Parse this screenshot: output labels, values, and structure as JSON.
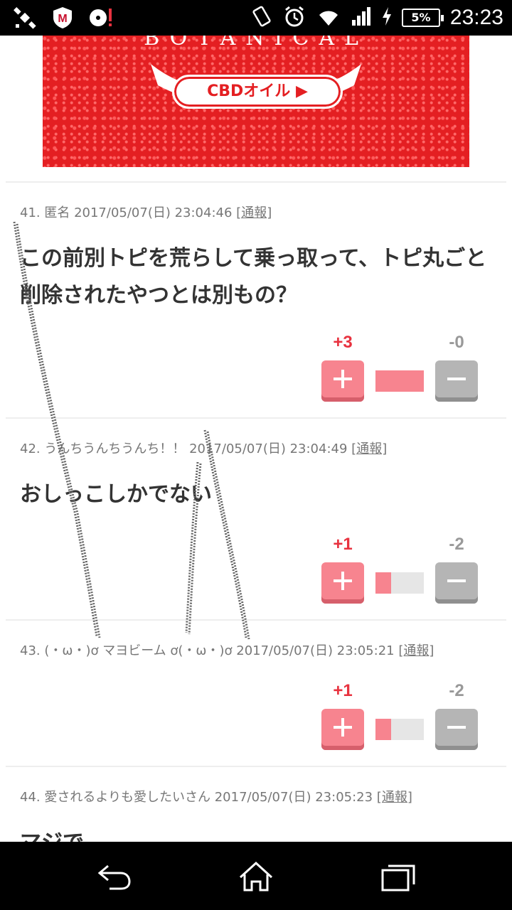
{
  "status_bar": {
    "time": "23:23",
    "battery": "5%"
  },
  "banner": {
    "brand": "BOTANICAL",
    "cta": "CBDオイル ▶"
  },
  "comments": [
    {
      "meta": "41. 匿名 2017/05/07(日) 23:04:46",
      "report": "[通報]",
      "body": "この前別トピを荒らして乗っ取って、トピ丸ごと削除されたやつとは別もの？",
      "plus": "+3",
      "minus": "-0",
      "ratio": 1.0
    },
    {
      "meta": "42. うんちうんちうんち！！ 2017/05/07(日) 23:04:49",
      "report": "[通報]",
      "body": "おしっこしかでない",
      "plus": "+1",
      "minus": "-2",
      "ratio": 0.33
    },
    {
      "meta": "43. (・ω・)ơ マヨビーム ơ(・ω・)ơ 2017/05/07(日) 23:05:21",
      "report": "[通報]",
      "body": "",
      "plus": "+1",
      "minus": "-2",
      "ratio": 0.33
    },
    {
      "meta": "44. 愛されるよりも愛したいさん 2017/05/07(日) 23:05:23",
      "report": "[通報]",
      "body": "マジで"
    }
  ],
  "icons": {
    "status_left": [
      "satellite-icon",
      "mcafee-icon",
      "disc-alert-icon"
    ],
    "status_right": [
      "vibrate-icon",
      "alarm-icon",
      "wifi-icon",
      "signal-icon",
      "charging-icon"
    ],
    "nav": [
      "back-icon",
      "home-icon",
      "recents-icon"
    ]
  },
  "colors": {
    "plus": "#f7848f",
    "plus_score": "#e8323f",
    "minus": "#b5b5b5",
    "banner": "#e41f22"
  }
}
